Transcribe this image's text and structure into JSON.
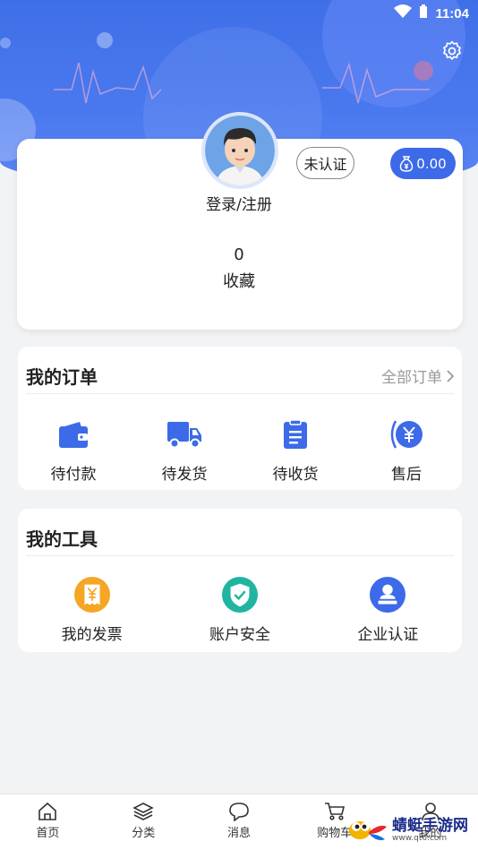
{
  "status_bar": {
    "time": "11:04"
  },
  "profile": {
    "login_label": "登录/注册",
    "certification_status": "未认证",
    "balance": "0.00",
    "favorites_count": "0",
    "favorites_label": "收藏"
  },
  "orders": {
    "title": "我的订单",
    "all_label": "全部订单",
    "items": [
      {
        "label": "待付款",
        "icon": "wallet-icon"
      },
      {
        "label": "待发货",
        "icon": "truck-icon"
      },
      {
        "label": "待收货",
        "icon": "clipboard-icon"
      },
      {
        "label": "售后",
        "icon": "yuan-refund-icon"
      }
    ]
  },
  "tools": {
    "title": "我的工具",
    "items": [
      {
        "label": "我的发票",
        "icon": "invoice-icon"
      },
      {
        "label": "账户安全",
        "icon": "shield-icon"
      },
      {
        "label": "企业认证",
        "icon": "enterprise-cert-icon"
      }
    ]
  },
  "tabbar": {
    "items": [
      {
        "label": "首页",
        "icon": "home-icon"
      },
      {
        "label": "分类",
        "icon": "layers-icon"
      },
      {
        "label": "消息",
        "icon": "chat-icon"
      },
      {
        "label": "购物车",
        "icon": "cart-icon"
      },
      {
        "label": "我的",
        "icon": "user-icon"
      }
    ]
  },
  "watermark": {
    "text": "蜻蜓手游网",
    "url": "www.qt6.com"
  },
  "colors": {
    "accent": "#3c6ae8",
    "hero": "#4a79ef",
    "invoice": "#f5a623",
    "shield": "#1fb5a0"
  }
}
